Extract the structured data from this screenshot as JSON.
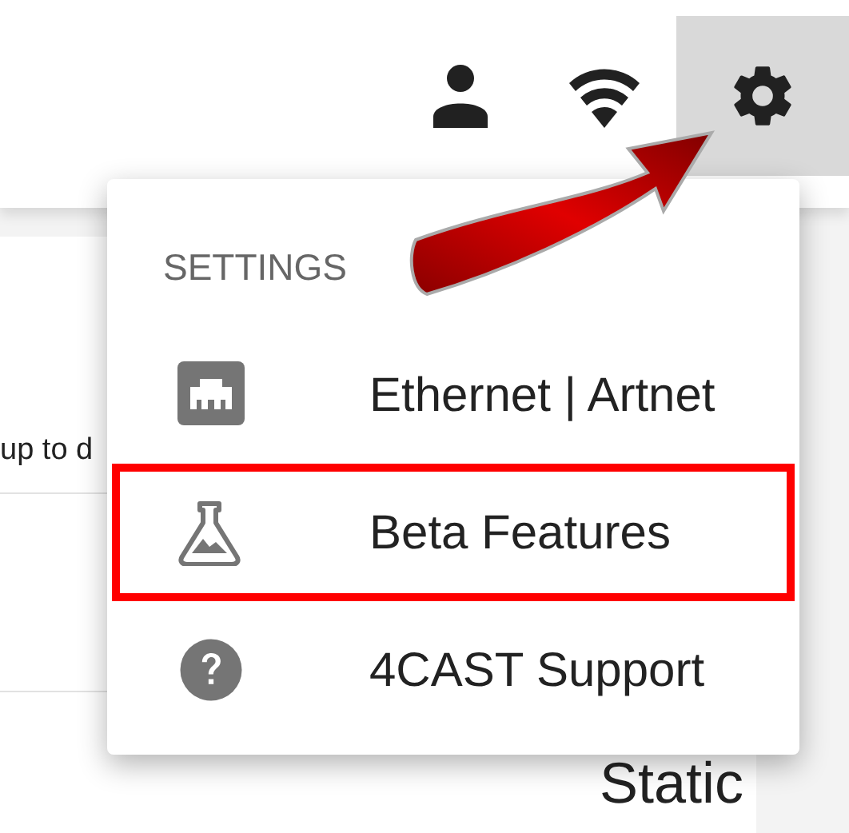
{
  "toolbar": {
    "buttons": [
      {
        "kind": "account",
        "selected": false
      },
      {
        "kind": "wifi",
        "selected": false
      },
      {
        "kind": "settings",
        "selected": true
      }
    ]
  },
  "page": {
    "snippet": "up to d",
    "value": "Static"
  },
  "menu": {
    "heading": "SETTINGS",
    "items": [
      {
        "kind": "ethernet",
        "label": "Ethernet | Artnet",
        "highlighted": false
      },
      {
        "kind": "beta",
        "label": "Beta Features",
        "highlighted": true
      },
      {
        "kind": "help",
        "label": "4CAST Support",
        "highlighted": false
      }
    ]
  }
}
